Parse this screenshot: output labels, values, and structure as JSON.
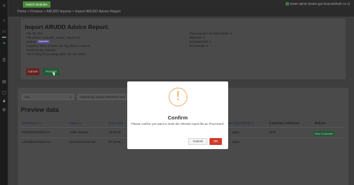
{
  "rail": {
    "icons": [
      "menu-icon",
      "home-icon",
      "chat-icon",
      "card-icon",
      "check-circle-icon",
      "list-icon",
      "document-icon",
      "folder-icon",
      "users-icon",
      "settings-icon"
    ]
  },
  "topbar": {
    "switch_label": "Switch Modules",
    "user_label": "tester-admin (tester-gov-bouneshhuth cx-1)"
  },
  "breadcrumb": "Home > Finance > ARUDD Imports > Import ARUDD Advice Report",
  "report": {
    "title": "Import ARUDD Advice Report:",
    "file_id": "File ID: 104",
    "file_name": "File Name: example_arudd_report.xml",
    "status_label": "Status:",
    "status_badge": "Imported",
    "imported_time": "Imported Time & Date: 26 Aug 2021 17:50:25",
    "imported_by": "Imported By: System",
    "third_party_date": "Third Party Processing Date: 30 Jan 2018",
    "total_instructions": "Total number of instructions: 2",
    "matched": "Matched: 1",
    "not_matched": "Not Matched: 1",
    "processed": "Processed: 0",
    "cancel_label": "Cancel",
    "process_label": "Process"
  },
  "filters": {
    "select_value": "Any",
    "search_placeholder": "Search by unique reference num"
  },
  "preview": {
    "title": "Preview data",
    "columns": {
      "reference": "Reference",
      "name": "Name",
      "sort_code": "Sort code",
      "description": "ion Description",
      "customer_ref": "Customer reference",
      "actions": "Actions"
    },
    "rows": [
      {
        "reference": "92b66f40109af8af4d",
        "name": "Judith Mayard",
        "sort_code": "12-33-34",
        "description": "… paper",
        "customer_ref": "1273",
        "action": "New Customer"
      },
      {
        "reference": "u81b6fjwx0zMpz2mn",
        "name": "Unmatched Record",
        "sort_code": "87-76-65",
        "description": "… paper",
        "customer_ref": "",
        "action": ""
      }
    ]
  },
  "modal": {
    "icon_glyph": "!",
    "title": "Confirm",
    "message": "Please confirm you want to mark the ARUDD report file as 'Processed'.",
    "cancel_label": "Cancel",
    "ok_label": "OK",
    "ok_color": "#cf3a2a",
    "warning_color": "#f0a85a"
  }
}
